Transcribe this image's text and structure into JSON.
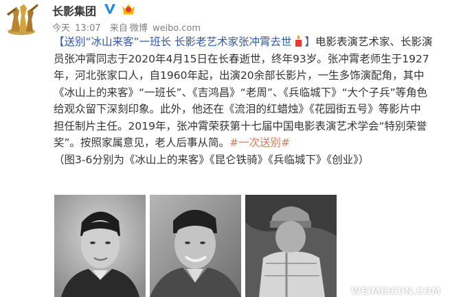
{
  "account": {
    "name": "长影集团",
    "verified_icon": "verified-v-icon",
    "badge_icon": "member-badge-icon"
  },
  "meta": {
    "date": "今天",
    "time": "13:07",
    "source_prefix": "来自",
    "source": "微博",
    "domain": "weibo.com"
  },
  "post": {
    "line1": {
      "bracket_open": "【",
      "title": "送别“冰山来客”一班长 长影老艺术家张冲霄去世",
      "bracket_close": "】",
      "text": "电影表演艺术家、长影演"
    },
    "line2": "员张冲霄同志于2020年4月15日在长春逝世，终年93岁。张冲霄老师生于1927",
    "line3": "年，河北张家口人，自1960年起，出演20余部长影片，一生多饰演配角，其中",
    "line4": "《冰山上的来客》“一班长”、《吉鸿昌》“老周”、《兵临城下》“大个子兵”等角色",
    "line5": "给观众留下深刻印象。此外，他还在《流泪的红蜡烛》《花园街五号》等影片中",
    "line6": "担任制片主任。2019年，张冲霄荣获第十七届中国电影表演艺术学会“特别荣誉",
    "line7": {
      "text": "奖”。按照家属意见，老人后事从简。",
      "hashtag": "#一次送别#"
    },
    "line8": "（图3-6分别为《冰山上的来客》《昆仑铁骑》《兵临城下》《创业》）",
    "emoji_icon": "candle-emoji-icon",
    "colors": {
      "link": "#3a5f9c",
      "hashtag": "#eb7350",
      "text": "#333333"
    }
  },
  "photos": {
    "items": [
      {
        "name": "portrait-young"
      },
      {
        "name": "portrait-smiling"
      },
      {
        "name": "soldier-still"
      }
    ],
    "watermark": "WEIMEICUN.COM"
  }
}
